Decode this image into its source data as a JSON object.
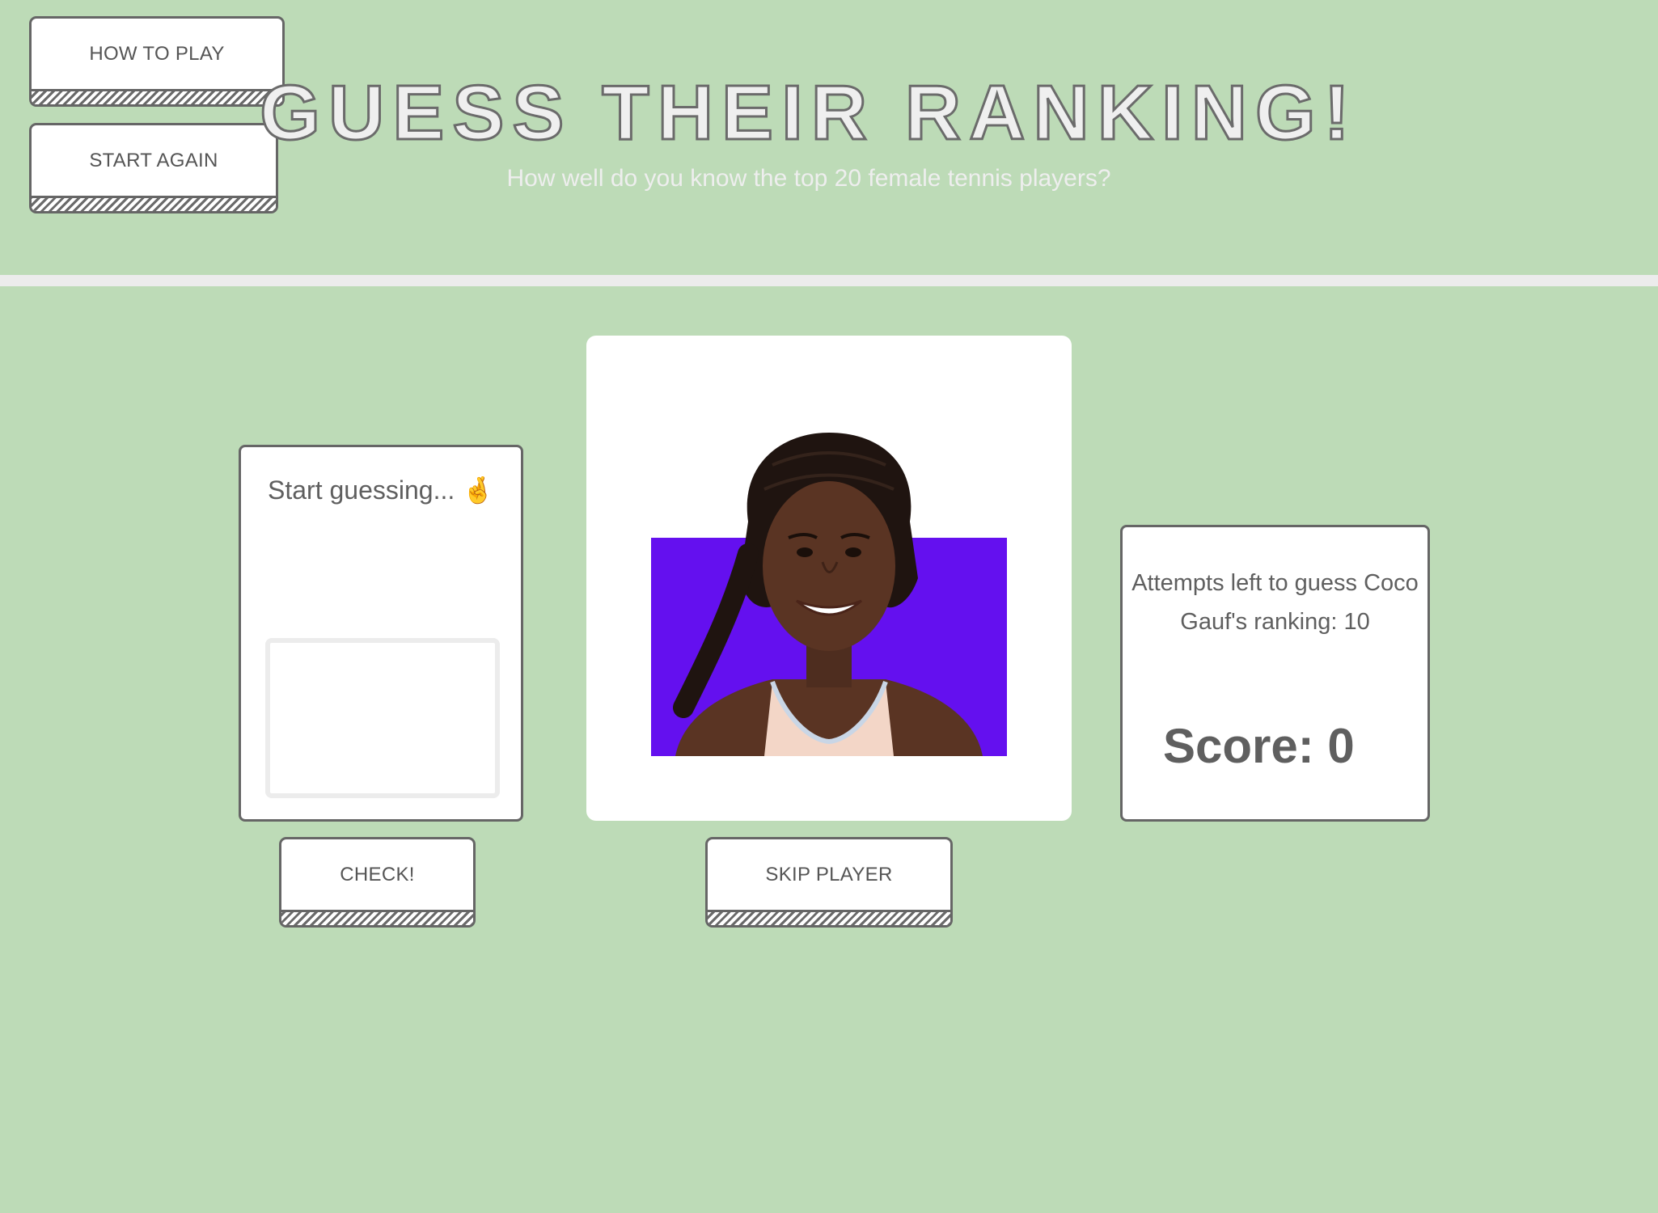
{
  "header": {
    "title": "GUESS THEIR RANKING!",
    "subtitle": "How well do you know the top 20 female tennis players?"
  },
  "controls": {
    "how_to_play": "HOW TO PLAY",
    "start_again": "START AGAIN",
    "check": "CHECK!",
    "skip_player": "SKIP PLAYER"
  },
  "guess": {
    "heading": "Start guessing... 🤞",
    "input_value": ""
  },
  "player": {
    "photo_icon": "player-portrait",
    "background_color": "#6410ef"
  },
  "info": {
    "attempts_text": "Attempts left to guess Coco Gauf's ranking: 10",
    "score_text": "Score: 0"
  },
  "colors": {
    "page_background": "#bddbb7",
    "divider": "#ececec",
    "border": "#666666"
  }
}
